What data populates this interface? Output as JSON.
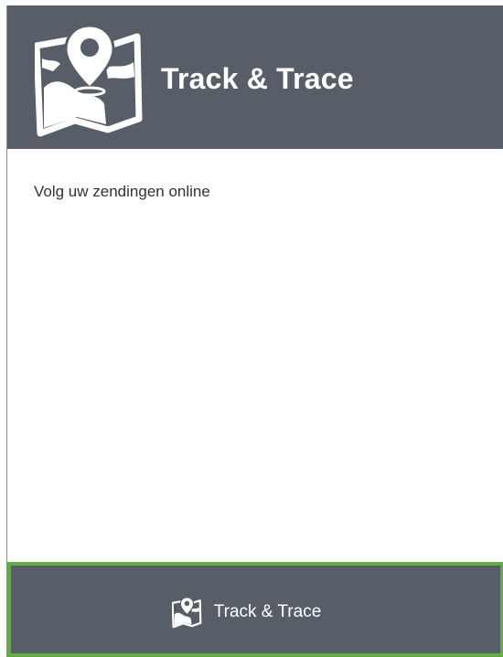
{
  "header": {
    "title": "Track & Trace",
    "icon": "map-pin-icon"
  },
  "body": {
    "description": "Volg uw zendingen online"
  },
  "footer": {
    "tab_label": "Track & Trace",
    "tab_icon": "map-pin-icon"
  },
  "colors": {
    "header_bg": "#575e67",
    "active_border": "#62ad3f",
    "text": "#333333"
  }
}
